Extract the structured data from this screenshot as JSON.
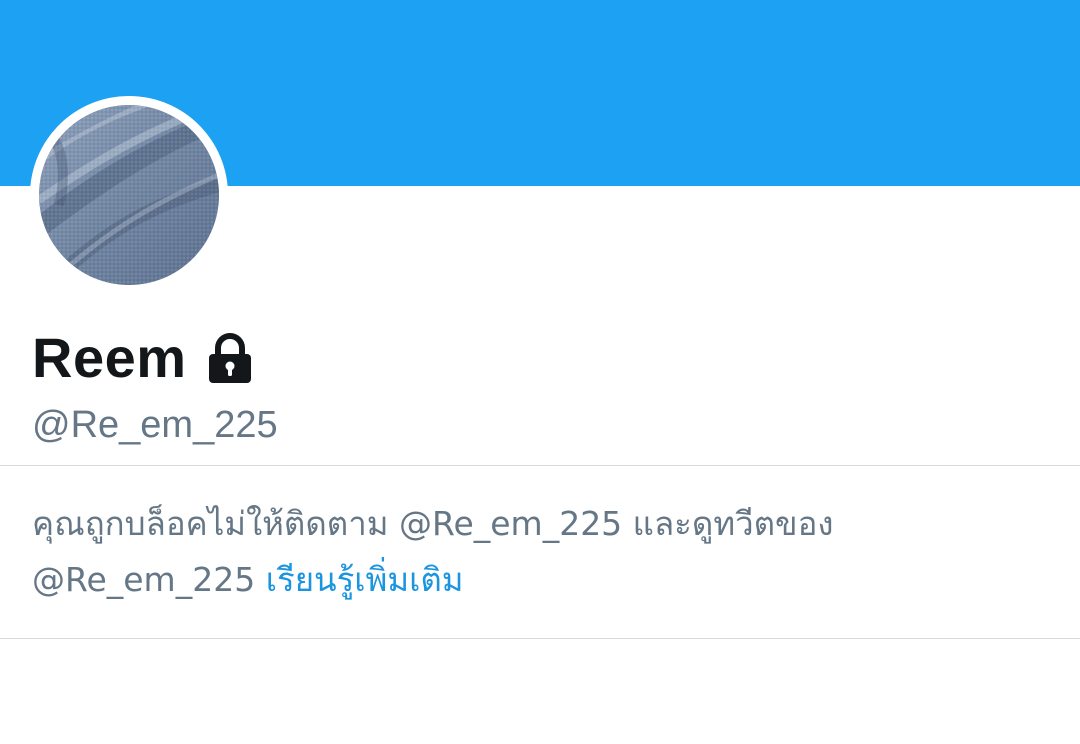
{
  "profile": {
    "display_name": "Reem",
    "handle": "@Re_em_225",
    "lock_icon": "lock-icon"
  },
  "notice": {
    "line1": "คุณถูกบล็อคไม่ให้ติดตาม @Re_em_225 และดูทวีตของ",
    "line2_handle": "@Re_em_225",
    "learn_more": "เรียนรู้เพิ่มเติม"
  },
  "colors": {
    "banner": "#1DA1F2",
    "text_primary": "#14171a",
    "text_secondary": "#657786",
    "link": "#1b95e0"
  }
}
